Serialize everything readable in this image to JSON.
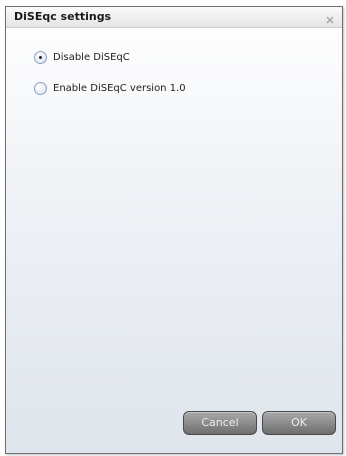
{
  "dialog": {
    "title": "DiSEqc settings",
    "close_icon": "close-icon"
  },
  "options": [
    {
      "label": "Disable DiSEqC",
      "checked": true
    },
    {
      "label": "Enable DiSEqC version 1.0",
      "checked": false
    }
  ],
  "buttons": {
    "cancel_label": "Cancel",
    "ok_label": "OK"
  },
  "colors": {
    "button_bg": "#8c8c8c",
    "button_text": "#ececec",
    "dialog_border": "#6f6f6f"
  }
}
